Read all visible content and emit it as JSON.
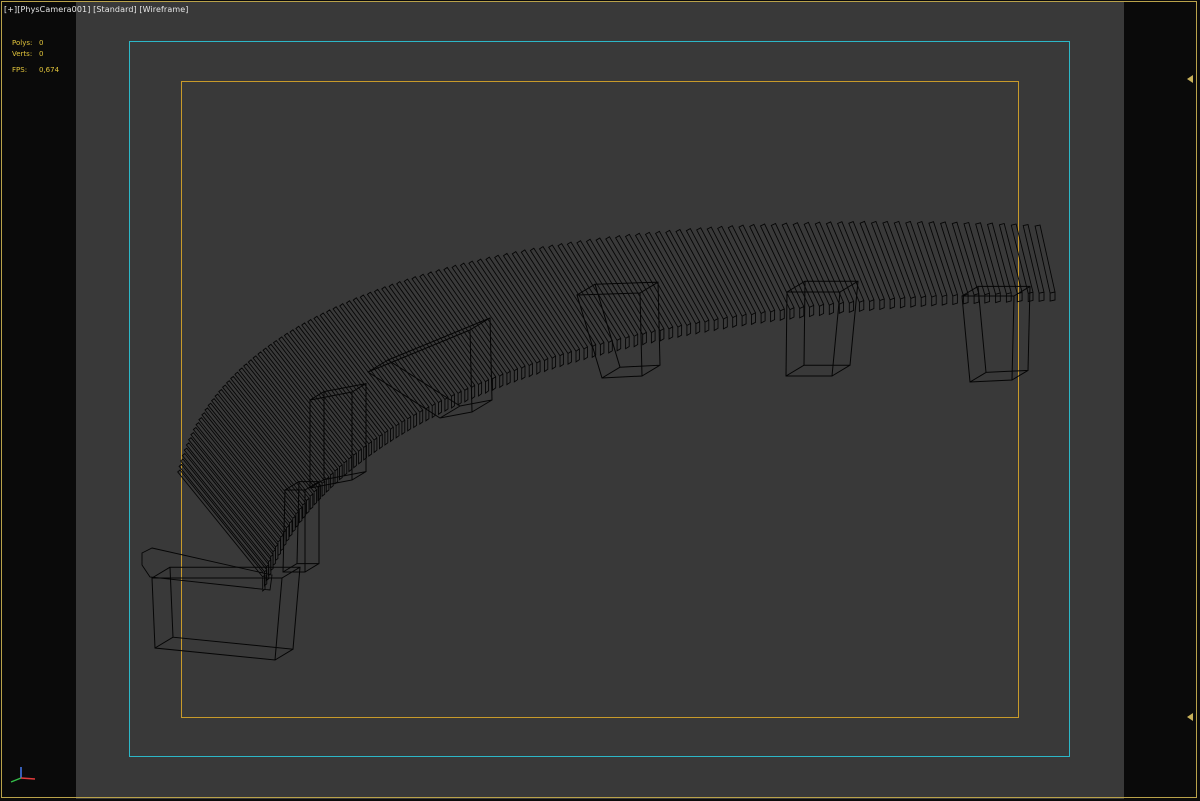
{
  "viewport": {
    "labels": [
      "[+]",
      "[PhysCamera001]",
      "[Standard]",
      "[Wireframe]"
    ],
    "stats": {
      "polys_label": "Polys:",
      "polys_value": "0",
      "verts_label": "Verts:",
      "verts_value": "0",
      "fps_label": "FPS:",
      "fps_value": "0,674"
    }
  },
  "colors": {
    "background": "#393939",
    "letterbox": "#0a0a0a",
    "safe_frame": "#2cb7c7",
    "action_frame": "#c89a2a",
    "border": "#b9a24a",
    "stats_text": "#e2c53b",
    "wireframe": "#000000"
  },
  "icons": {
    "frame_marker": "triangle-marker-icon",
    "axis": "axis-tripod-icon"
  }
}
